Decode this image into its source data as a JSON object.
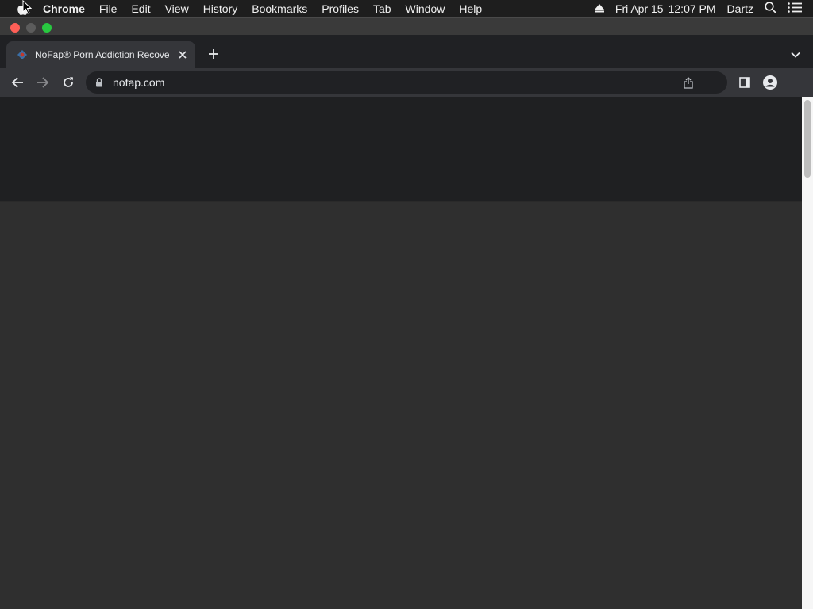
{
  "menubar": {
    "app_name": "Chrome",
    "items": [
      "File",
      "Edit",
      "View",
      "History",
      "Bookmarks",
      "Profiles",
      "Tab",
      "Window",
      "Help"
    ],
    "date": "Fri Apr 15",
    "time": "12:07 PM",
    "user": "Dartz"
  },
  "tabs": [
    {
      "title": "NoFap® Porn Addiction Recove"
    }
  ],
  "omnibox": {
    "url": "nofap.com"
  },
  "colors": {
    "close_light": "#fe5f57",
    "zoom_light": "#28c840",
    "page_header": "#1f2022",
    "page_body": "#2f2f2f"
  }
}
